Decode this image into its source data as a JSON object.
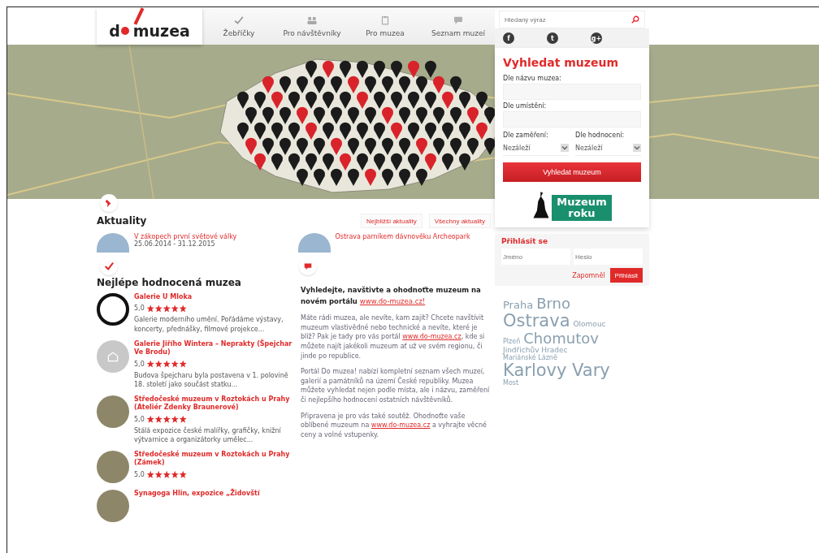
{
  "logo": {
    "before": "d",
    "after": "muzea"
  },
  "nav": [
    {
      "label": "Žebříčky",
      "selected": false
    },
    {
      "label": "Pro návštěvníky",
      "selected": false
    },
    {
      "label": "Pro muzea",
      "selected": false
    },
    {
      "label": "Seznam muzeí",
      "selected": false
    }
  ],
  "search": {
    "placeholder": "Hledaný výraz"
  },
  "social": [
    {
      "label": "f"
    },
    {
      "label": "t"
    },
    {
      "label": "g+"
    }
  ],
  "finder": {
    "title": "Vyhledat muzeum",
    "name_label": "Dle názvu muzea:",
    "place_label": "Dle umístění:",
    "focus_label": "Dle zaměření:",
    "focus_value": "Nezáleží",
    "rating_label": "Dle hodnocení:",
    "rating_value": "Nezáleží",
    "button": "Vyhledat muzeum"
  },
  "award": {
    "line1": "Muzeum",
    "line2": "roku"
  },
  "login": {
    "title": "Přihlásit se",
    "user_placeholder": "Jméno",
    "pass_placeholder": "Heslo",
    "forgot": "Zapomněl",
    "button": "Přihlásit"
  },
  "tags": [
    {
      "label": "Praha",
      "kind": "m"
    },
    {
      "label": "Brno",
      "kind": "l"
    },
    {
      "label": "Ostrava",
      "kind": "xl"
    },
    {
      "label": "Olomouc",
      "kind": "s"
    },
    {
      "label": "Plzeň",
      "kind": "xs"
    },
    {
      "label": "Chomutov",
      "kind": "l"
    },
    {
      "label": "Jindřichův Hradec",
      "kind": "s"
    },
    {
      "label": "Mariánské Lázně",
      "kind": "xs"
    },
    {
      "label": "Karlovy Vary",
      "kind": "xl"
    },
    {
      "label": "Most",
      "kind": "xs"
    }
  ],
  "news": {
    "title": "Aktuality",
    "buttons": [
      "Nejbližší aktuality",
      "Všechny aktuality"
    ],
    "items": [
      {
        "title": "V zákopech první světové války",
        "date": "25.06.2014 - 31.12.2015"
      },
      {
        "title": "Ostrava parníkem dávnověku Archeopark"
      }
    ]
  },
  "top": {
    "title": "Nejlépe hodnocená muzea",
    "items": [
      {
        "name": "Galerie U Mloka",
        "rating": "5,0",
        "stars": 5,
        "text": "Galerie moderního umění. Pořádáme výstavy, koncerty, přednášky, filmové projekce..."
      },
      {
        "name": "Galerie Jiřího Wintera – Neprakty (Špejchar Ve Brodu)",
        "rating": "5,0",
        "stars": 5,
        "text": "Budova špejcharu byla postavena v 1. polovině 18. století jako součást statku..."
      },
      {
        "name": "Středočeské muzeum v Roztokách u Prahy (Ateliér Zdenky Braunerové)",
        "rating": "5,0",
        "stars": 5,
        "text": "Stálá expozice české malířky, grafičky, knižní výtvarnice a organizátorky umělec..."
      },
      {
        "name": "Středočeské muzeum v Roztokách u Prahy (Zámek)",
        "rating": "5,0",
        "stars": 5
      },
      {
        "name": "Synagoga Hlin, expozice „Židovští"
      }
    ]
  },
  "intro": {
    "lead": "Vyhledejte, navštivte a ohodnoťte muzeum na novém portálu",
    "lead_link": "www.do-muzea.cz!",
    "paragraphs": [
      [
        {
          "text": "Máte rádi muzea, ale nevíte, kam zajít? Chcete navštívit muzeum vlastivědné nebo technické a nevíte, které je blíž? Pak je tady pro vás portál "
        },
        {
          "link": "www.do-muzea.cz"
        },
        {
          "text": ", kde si můžete najít jakékoli muzeum ať už ve svém regionu, či jinde po republice."
        }
      ],
      [
        {
          "text": "Portál Do muzea! nabízí kompletní seznam všech muzeí, galerií a památníků na území České republiky. Muzea můžete vyhledat nejen podle místa, ale i názvu, zaměření či nejlepšího hodnocení ostatních návštěvníků."
        }
      ],
      [
        {
          "text": "Připravena je pro vás také soutěž. Ohodnoťte vaše oblíbené muzeum na "
        },
        {
          "link": "www.do-muzea.cz"
        },
        {
          "text": " a vyhrajte věcné ceny a volné vstupenky."
        }
      ]
    ]
  }
}
